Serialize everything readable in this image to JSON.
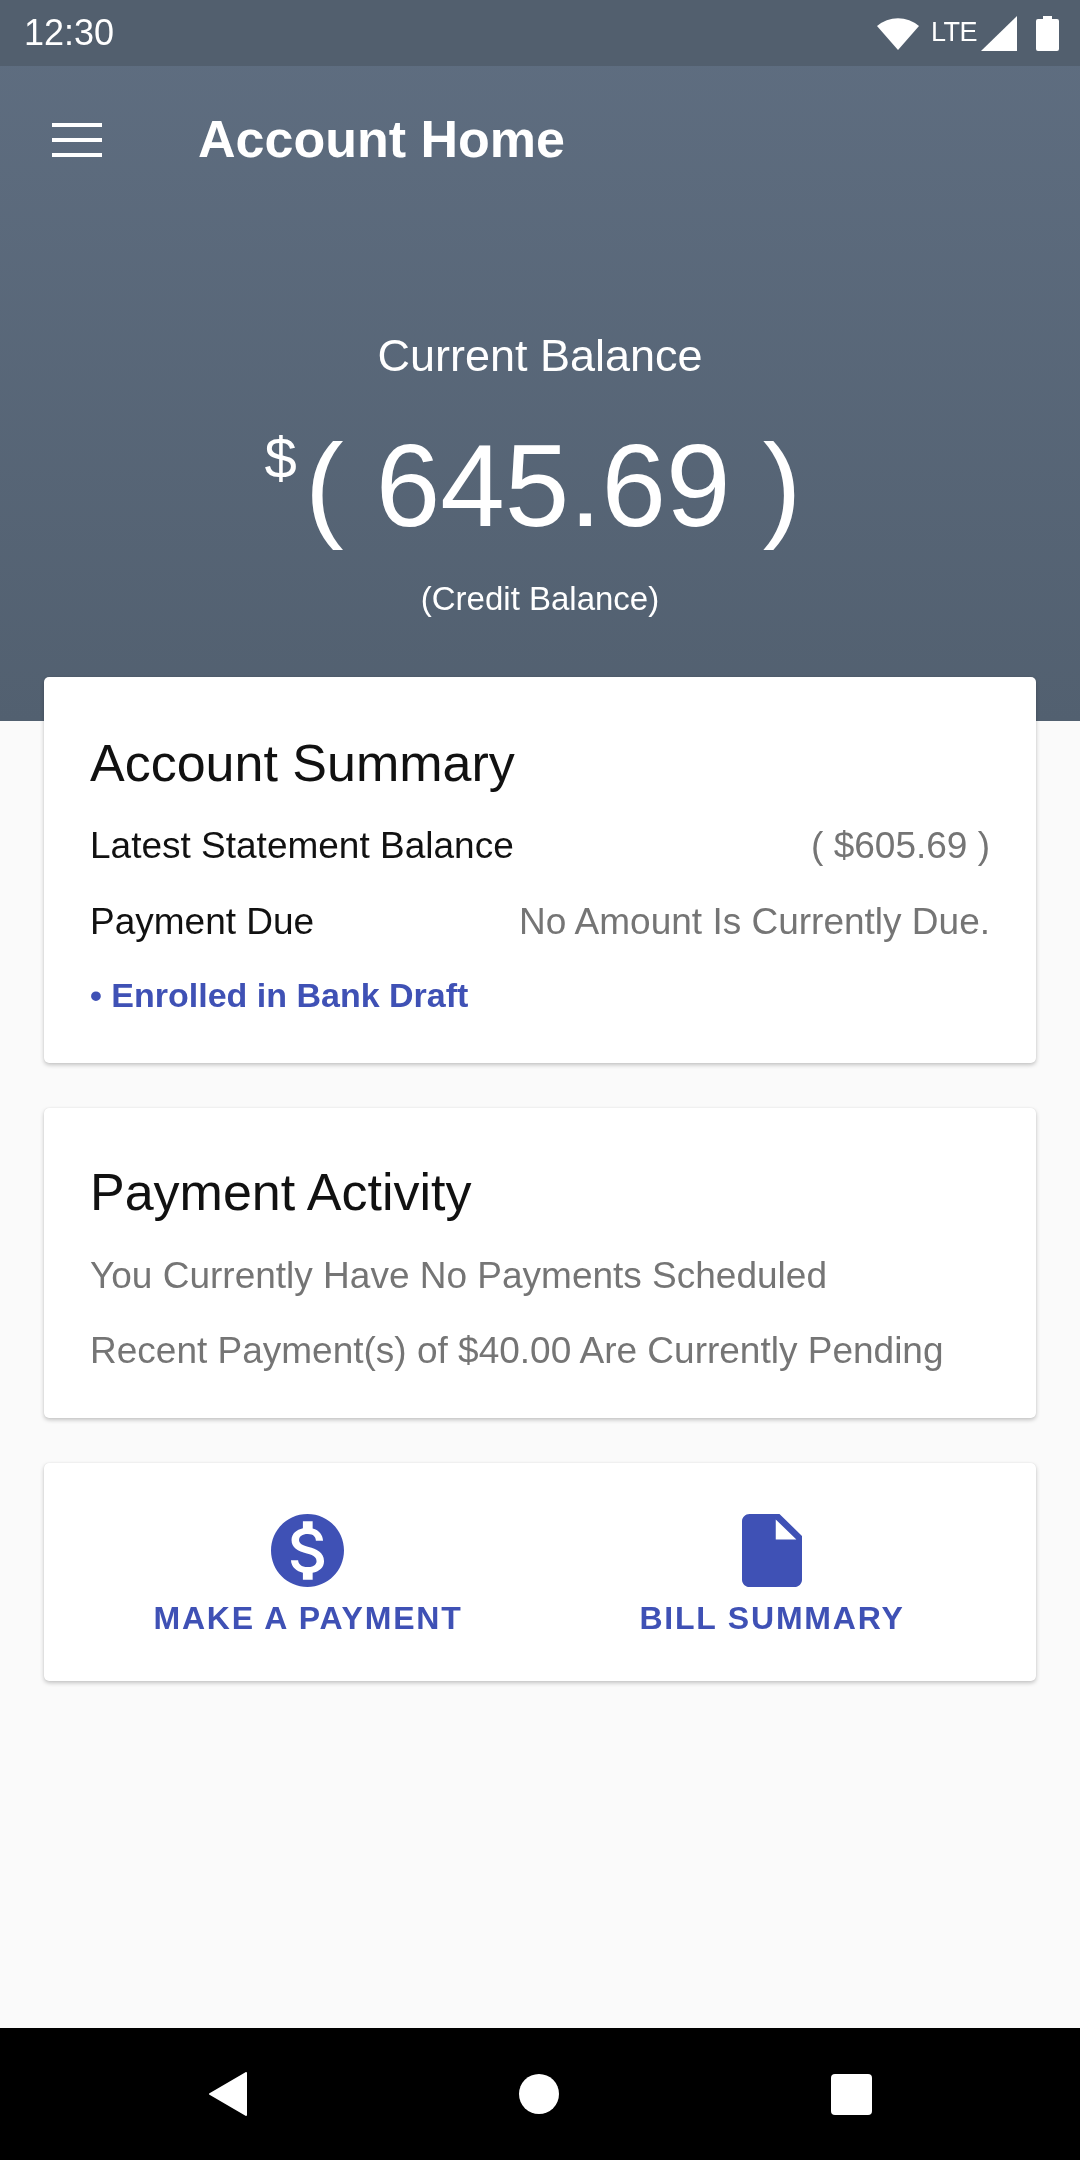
{
  "status_bar": {
    "time": "12:30",
    "network": "LTE"
  },
  "app_bar": {
    "title": "Account Home"
  },
  "balance": {
    "label": "Current Balance",
    "currency": "$",
    "amount": "( 645.69 )",
    "note": "(Credit Balance)"
  },
  "account_summary": {
    "title": "Account Summary",
    "rows": [
      {
        "label": "Latest Statement Balance",
        "value": "( $605.69 )"
      },
      {
        "label": "Payment Due",
        "value": "No Amount Is Currently Due."
      }
    ],
    "enrollment": "• Enrolled in Bank Draft"
  },
  "payment_activity": {
    "title": "Payment Activity",
    "lines": [
      "You Currently Have No Payments Scheduled",
      "Recent Payment(s) of $40.00 Are Currently Pending"
    ]
  },
  "actions": [
    {
      "kind": "payment",
      "label": "MAKE A PAYMENT"
    },
    {
      "kind": "bill",
      "label": "BILL SUMMARY"
    }
  ]
}
